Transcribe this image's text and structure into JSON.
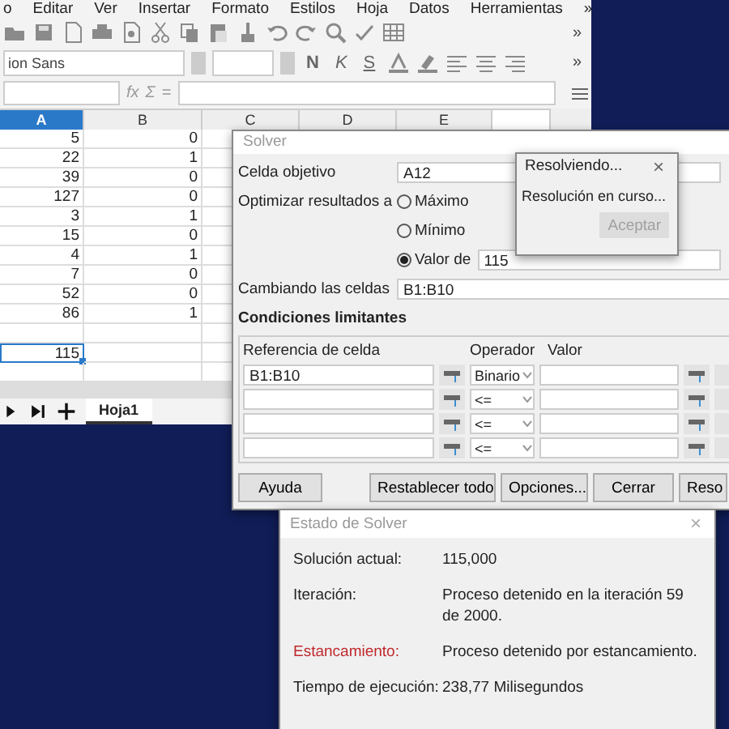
{
  "calc": {
    "menu": [
      "o",
      "Editar",
      "Ver",
      "Insertar",
      "Formato",
      "Estilos",
      "Hoja",
      "Datos",
      "Herramientas",
      "»"
    ],
    "toolbar_more": "»",
    "font_name": "ion Sans",
    "format_buttons": [
      "N",
      "K",
      "S"
    ],
    "format_more": "»",
    "formula_buttons": [
      "fx",
      "Σ",
      "="
    ],
    "columns": [
      {
        "label": "A",
        "selected": true
      },
      {
        "label": "B",
        "selected": false
      },
      {
        "label": "C",
        "selected": false
      },
      {
        "label": "D",
        "selected": false
      },
      {
        "label": "E",
        "selected": false
      }
    ],
    "rows": [
      {
        "a": "5",
        "b": "0",
        "selected": false
      },
      {
        "a": "22",
        "b": "1",
        "selected": false
      },
      {
        "a": "39",
        "b": "0",
        "selected": false
      },
      {
        "a": "127",
        "b": "0",
        "selected": false
      },
      {
        "a": "3",
        "b": "1",
        "selected": false
      },
      {
        "a": "15",
        "b": "0",
        "selected": false
      },
      {
        "a": "4",
        "b": "1",
        "selected": false
      },
      {
        "a": "7",
        "b": "0",
        "selected": false
      },
      {
        "a": "52",
        "b": "0",
        "selected": false
      },
      {
        "a": "86",
        "b": "1",
        "selected": false
      },
      {
        "selected": false
      },
      {
        "a": "115",
        "selected": true
      },
      {
        "selected": false
      }
    ],
    "sheet_tabs": [
      {
        "label": "Hoja1",
        "selected": true
      }
    ]
  },
  "solver": {
    "title": "Solver",
    "target_label": "Celda objetivo",
    "target_value": "A12",
    "optimize_label": "Optimizar resultados a",
    "options": [
      {
        "label": "Máximo",
        "selected": false
      },
      {
        "label": "Mínimo",
        "selected": false
      },
      {
        "label": "Valor de",
        "selected": true,
        "value": "115"
      }
    ],
    "changing_label": "Cambiando las celdas",
    "changing_value": "B1:B10",
    "constraints_title": "Condiciones limitantes",
    "constraint_columns": [
      "Referencia de celda",
      "Operador",
      "Valor"
    ],
    "constraints": [
      {
        "reference": "B1:B10",
        "operator": "Binario"
      },
      {
        "operator": "<="
      },
      {
        "operator": "<="
      },
      {
        "operator": "<="
      }
    ],
    "buttons": [
      "Ayuda",
      "Restablecer todo",
      "Opciones...",
      "Cerrar",
      "Reso"
    ]
  },
  "progress": {
    "title": "Resolviendo...",
    "close": "×",
    "message": "Resolución en curso...",
    "button": {
      "label": "Aceptar",
      "disabled": true
    }
  },
  "status": {
    "title": "Estado de Solver",
    "close": "×",
    "rows": [
      {
        "label": "Solución actual:",
        "value": "115,000",
        "kind": "normal"
      },
      {
        "label": "Iteración:",
        "value": "Proceso detenido en la iteración 59 de 2000.",
        "kind": "normal"
      },
      {
        "label": "Estancamiento:",
        "value": "Proceso detenido por estancamiento.",
        "kind": "warning"
      },
      {
        "label": "Tiempo de ejecución:",
        "value": "238,77 Milisegundos",
        "kind": "normal"
      }
    ]
  }
}
